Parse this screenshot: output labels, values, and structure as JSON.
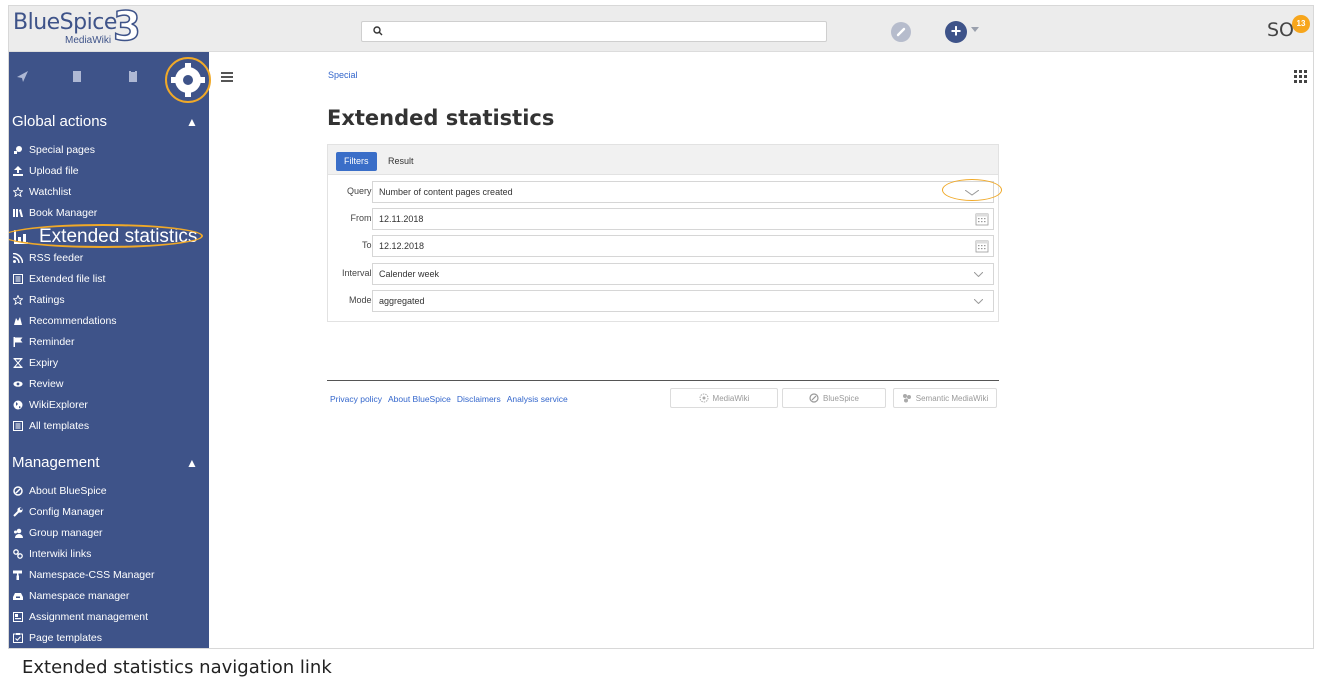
{
  "header": {
    "logo_word": "BlueSpice",
    "logo_sub": "MediaWiki",
    "logo_version": "3",
    "search_icon": "search-icon",
    "edit_icon": "pencil-icon",
    "add_icon": "plus-icon",
    "user_initials": "SO",
    "notification_count": "13"
  },
  "sidebar": {
    "tab_icons": [
      "navigation-icon",
      "book-icon",
      "clipboard-icon",
      "gear-icon"
    ],
    "global_actions": {
      "heading": "Global actions",
      "items": [
        {
          "label": "Special pages",
          "icon": "special-pages-icon"
        },
        {
          "label": "Upload file",
          "icon": "upload-icon"
        },
        {
          "label": "Watchlist",
          "icon": "star-icon"
        },
        {
          "label": "Book Manager",
          "icon": "book-manager-icon"
        },
        {
          "label": "Extended statistics",
          "icon": "chart-icon"
        },
        {
          "label": "RSS feeder",
          "icon": "rss-icon"
        },
        {
          "label": "Extended file list",
          "icon": "file-list-icon"
        },
        {
          "label": "Ratings",
          "icon": "star-icon"
        },
        {
          "label": "Recommendations",
          "icon": "thumb-icon"
        },
        {
          "label": "Reminder",
          "icon": "flag-icon"
        },
        {
          "label": "Expiry",
          "icon": "hourglass-icon"
        },
        {
          "label": "Review",
          "icon": "eye-icon"
        },
        {
          "label": "WikiExplorer",
          "icon": "globe-icon"
        },
        {
          "label": "All templates",
          "icon": "template-icon"
        }
      ]
    },
    "management": {
      "heading": "Management",
      "items": [
        {
          "label": "About BlueSpice",
          "icon": "bluespice-icon"
        },
        {
          "label": "Config Manager",
          "icon": "wrench-icon"
        },
        {
          "label": "Group manager",
          "icon": "group-icon"
        },
        {
          "label": "Interwiki links",
          "icon": "link-icon"
        },
        {
          "label": "Namespace-CSS Manager",
          "icon": "paint-roller-icon"
        },
        {
          "label": "Namespace manager",
          "icon": "inbox-icon"
        },
        {
          "label": "Assignment management",
          "icon": "assignment-icon"
        },
        {
          "label": "Page templates",
          "icon": "page-template-icon"
        }
      ]
    }
  },
  "main": {
    "breadcrumb": "Special",
    "title": "Extended statistics",
    "tabs": [
      "Filters",
      "Result"
    ],
    "fields": [
      {
        "label": "Query:",
        "value": "Number of content pages created",
        "control": "dropdown"
      },
      {
        "label": "From:",
        "value": "12.11.2018",
        "control": "date"
      },
      {
        "label": "To:",
        "value": "12.12.2018",
        "control": "date"
      },
      {
        "label": "Interval:",
        "value": "Calender week",
        "control": "dropdown"
      },
      {
        "label": "Mode:",
        "value": "aggregated",
        "control": "dropdown"
      }
    ]
  },
  "footer": {
    "links": [
      "Privacy policy",
      "About BlueSpice",
      "Disclaimers",
      "Analysis service"
    ],
    "badges": [
      "MediaWiki",
      "BlueSpice",
      "Semantic MediaWiki"
    ]
  },
  "caption": "Extended statistics navigation link",
  "colors": {
    "sidebar_bg": "#3e5389",
    "accent": "#3a6ec8",
    "highlight": "#f0a928"
  }
}
